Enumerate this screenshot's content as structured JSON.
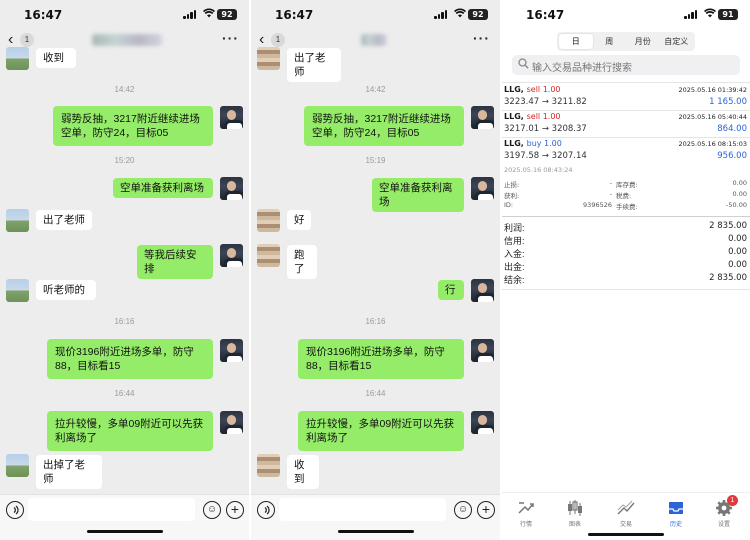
{
  "statusbar": [
    {
      "time": "16:47",
      "battery": "92"
    },
    {
      "time": "16:47",
      "battery": "92"
    },
    {
      "time": "16:47",
      "battery": "91"
    }
  ],
  "chat1": {
    "unread": "1",
    "messages": [
      {
        "kind": "in",
        "text": "收到"
      },
      {
        "kind": "time",
        "text": "14:42"
      },
      {
        "kind": "out",
        "text": "弱势反抽，3217附近继续进场空单，防守24，目标05"
      },
      {
        "kind": "time",
        "text": "15:20"
      },
      {
        "kind": "out",
        "text": "空单准备获利离场"
      },
      {
        "kind": "in",
        "text": "出了老师"
      },
      {
        "kind": "out",
        "text": "等我后续安排"
      },
      {
        "kind": "in",
        "text": "听老师的"
      },
      {
        "kind": "time",
        "text": "16:16"
      },
      {
        "kind": "out",
        "text": "现价3196附近进场多单，防守88，目标看15"
      },
      {
        "kind": "time",
        "text": "16:44"
      },
      {
        "kind": "out",
        "text": "拉升较慢，多单09附近可以先获利离场了"
      },
      {
        "kind": "in",
        "text": "出掉了老师"
      }
    ]
  },
  "chat2": {
    "unread": "1",
    "messages": [
      {
        "kind": "in",
        "text": "出了老师"
      },
      {
        "kind": "time",
        "text": "14:42"
      },
      {
        "kind": "out",
        "text": "弱势反抽，3217附近继续进场空单，防守24，目标05"
      },
      {
        "kind": "time",
        "text": "15:19"
      },
      {
        "kind": "out",
        "text": "空单准备获利离场"
      },
      {
        "kind": "in",
        "text": "好"
      },
      {
        "kind": "in",
        "text": "跑了"
      },
      {
        "kind": "out",
        "text": "行"
      },
      {
        "kind": "time",
        "text": "16:16"
      },
      {
        "kind": "out",
        "text": "现价3196附近进场多单，防守88，目标看15"
      },
      {
        "kind": "time",
        "text": "16:44"
      },
      {
        "kind": "out",
        "text": "拉升较慢，多单09附近可以先获利离场了"
      },
      {
        "kind": "in",
        "text": "收到"
      }
    ]
  },
  "trade": {
    "segments": [
      "日",
      "周",
      "月份",
      "自定义"
    ],
    "active_segment": "日",
    "search_placeholder": "输入交易品种进行搜索",
    "deals": [
      {
        "symbol": "LLG,",
        "side": "sell 1.00",
        "side_type": "sell",
        "datetime": "2025.05.16 01:39:42",
        "prices": "3223.47 → 3211.82",
        "profit": "1 165.00"
      },
      {
        "symbol": "LLG,",
        "side": "sell 1.00",
        "side_type": "sell",
        "datetime": "2025.05.16 05:40:44",
        "prices": "3217.01 → 3208.37",
        "profit": "864.00"
      },
      {
        "symbol": "LLG,",
        "side": "buy 1.00",
        "side_type": "buy",
        "datetime": "2025.05.16 08:15:03",
        "prices": "3197.58 → 3207.14",
        "profit": "956.00"
      }
    ],
    "detail": {
      "open_time": "2025.05.16 08:43:24",
      "rows": [
        {
          "l1": "止损:",
          "v1": "-",
          "l2": "库存费:",
          "v2": "0.00"
        },
        {
          "l1": "获利:",
          "v1": "-",
          "l2": "税费:",
          "v2": "0.00"
        },
        {
          "l1": "ID:",
          "v1": "9396526",
          "l2": "手续费:",
          "v2": "-50.00"
        }
      ]
    },
    "summary": [
      {
        "k": "利润:",
        "v": "2 835.00"
      },
      {
        "k": "信用:",
        "v": "0.00"
      },
      {
        "k": "入金:",
        "v": "0.00"
      },
      {
        "k": "出金:",
        "v": "0.00"
      },
      {
        "k": "结余:",
        "v": "2 835.00"
      }
    ],
    "tabs": [
      {
        "label": "行情",
        "icon": "quotes-icon"
      },
      {
        "label": "图表",
        "icon": "chart-icon"
      },
      {
        "label": "交易",
        "icon": "trade-icon"
      },
      {
        "label": "历史",
        "icon": "history-icon"
      },
      {
        "label": "设置",
        "icon": "settings-icon"
      }
    ],
    "active_tab": "历史",
    "settings_badge": "1",
    "colors": {
      "sell": "#d92424",
      "buy": "#2a64d6",
      "accent": "#2a64d6"
    }
  }
}
